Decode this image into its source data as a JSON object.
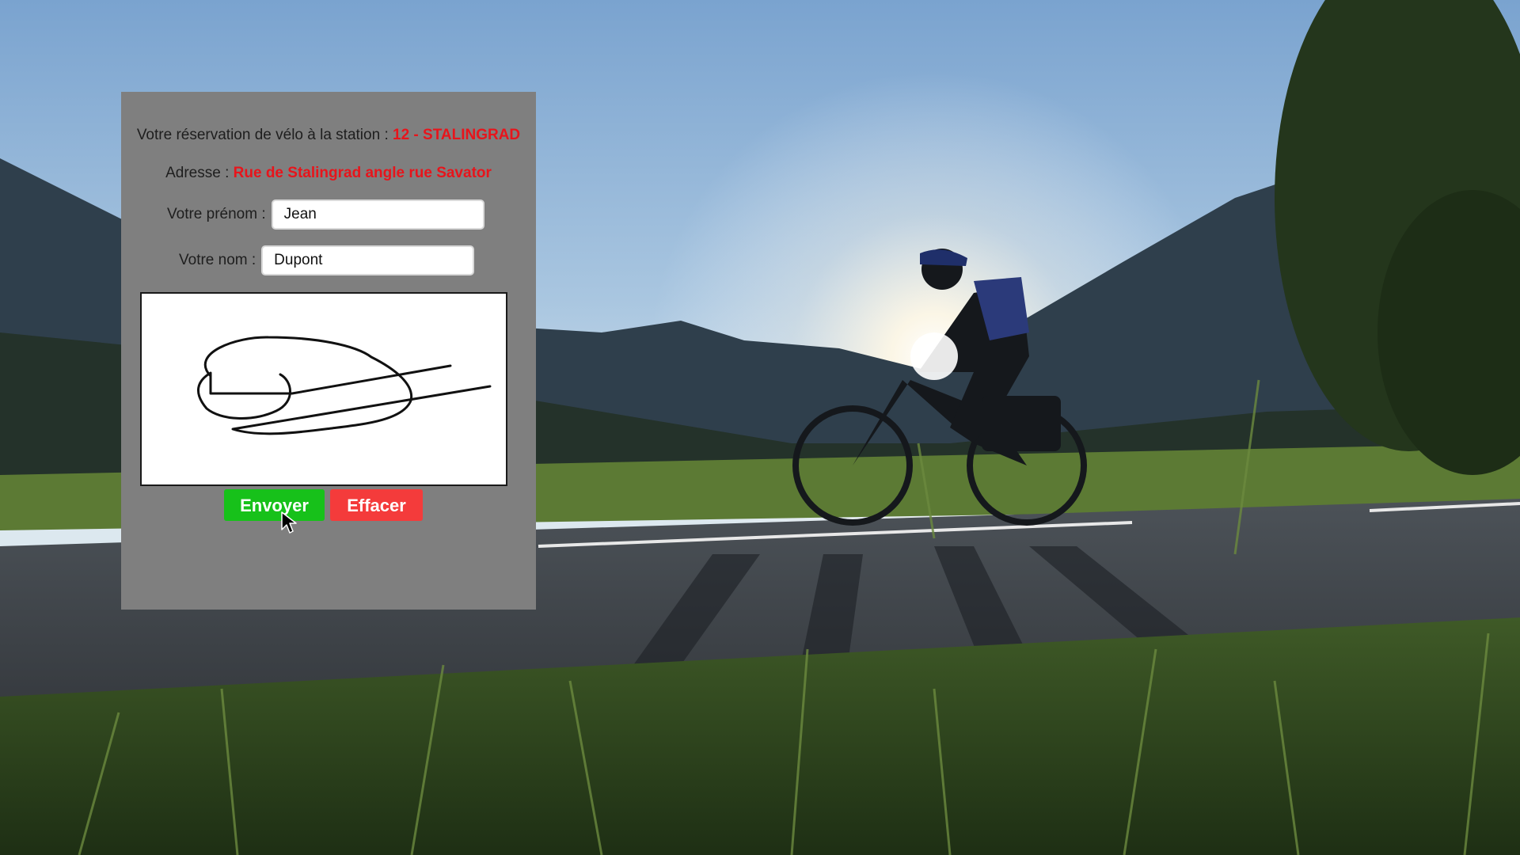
{
  "reservation": {
    "station_prefix": "Votre réservation de vélo à la station : ",
    "station_name": "12 - STALINGRAD",
    "address_prefix": "Adresse : ",
    "address_value": "Rue de Stalingrad angle rue Savator"
  },
  "form": {
    "firstname_label": "Votre prénom :",
    "firstname_value": "Jean",
    "lastname_label": "Votre nom :",
    "lastname_value": "Dupont"
  },
  "buttons": {
    "send_label": "Envoyer",
    "clear_label": "Effacer"
  },
  "colors": {
    "panel_background": "#7f7f7f",
    "highlight_text": "#e8141b",
    "send_button": "#17c11a",
    "clear_button": "#f43b3b"
  },
  "icons": {
    "cursor": "arrow-cursor-icon",
    "signature": "signature-drawing"
  }
}
